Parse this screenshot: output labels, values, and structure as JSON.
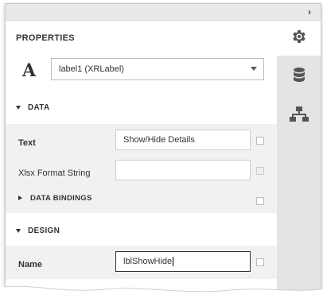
{
  "panel": {
    "title": "PROPERTIES",
    "collapse_glyph": "›",
    "selected_control": "label1 (XRLabel)",
    "font_glyph": "A"
  },
  "tabs": [
    {
      "name": "properties",
      "icon": "gear-icon",
      "active": true
    },
    {
      "name": "field-list",
      "icon": "database-icon",
      "active": false
    },
    {
      "name": "report-explorer",
      "icon": "hierarchy-icon",
      "active": false
    }
  ],
  "groups": {
    "data": {
      "label": "DATA",
      "properties": {
        "text": {
          "label": "Text",
          "value": "Show/Hide Details"
        },
        "xlsx": {
          "label": "Xlsx Format String",
          "value": ""
        }
      },
      "bindings": {
        "label": "DATA BINDINGS"
      }
    },
    "design": {
      "label": "DESIGN",
      "properties": {
        "name": {
          "label": "Name",
          "value": "lblShowHide"
        }
      }
    }
  },
  "colors": {
    "panel_bg": "#e4e4e4",
    "row_bg": "#f1f1f1",
    "icon": "#555555"
  }
}
